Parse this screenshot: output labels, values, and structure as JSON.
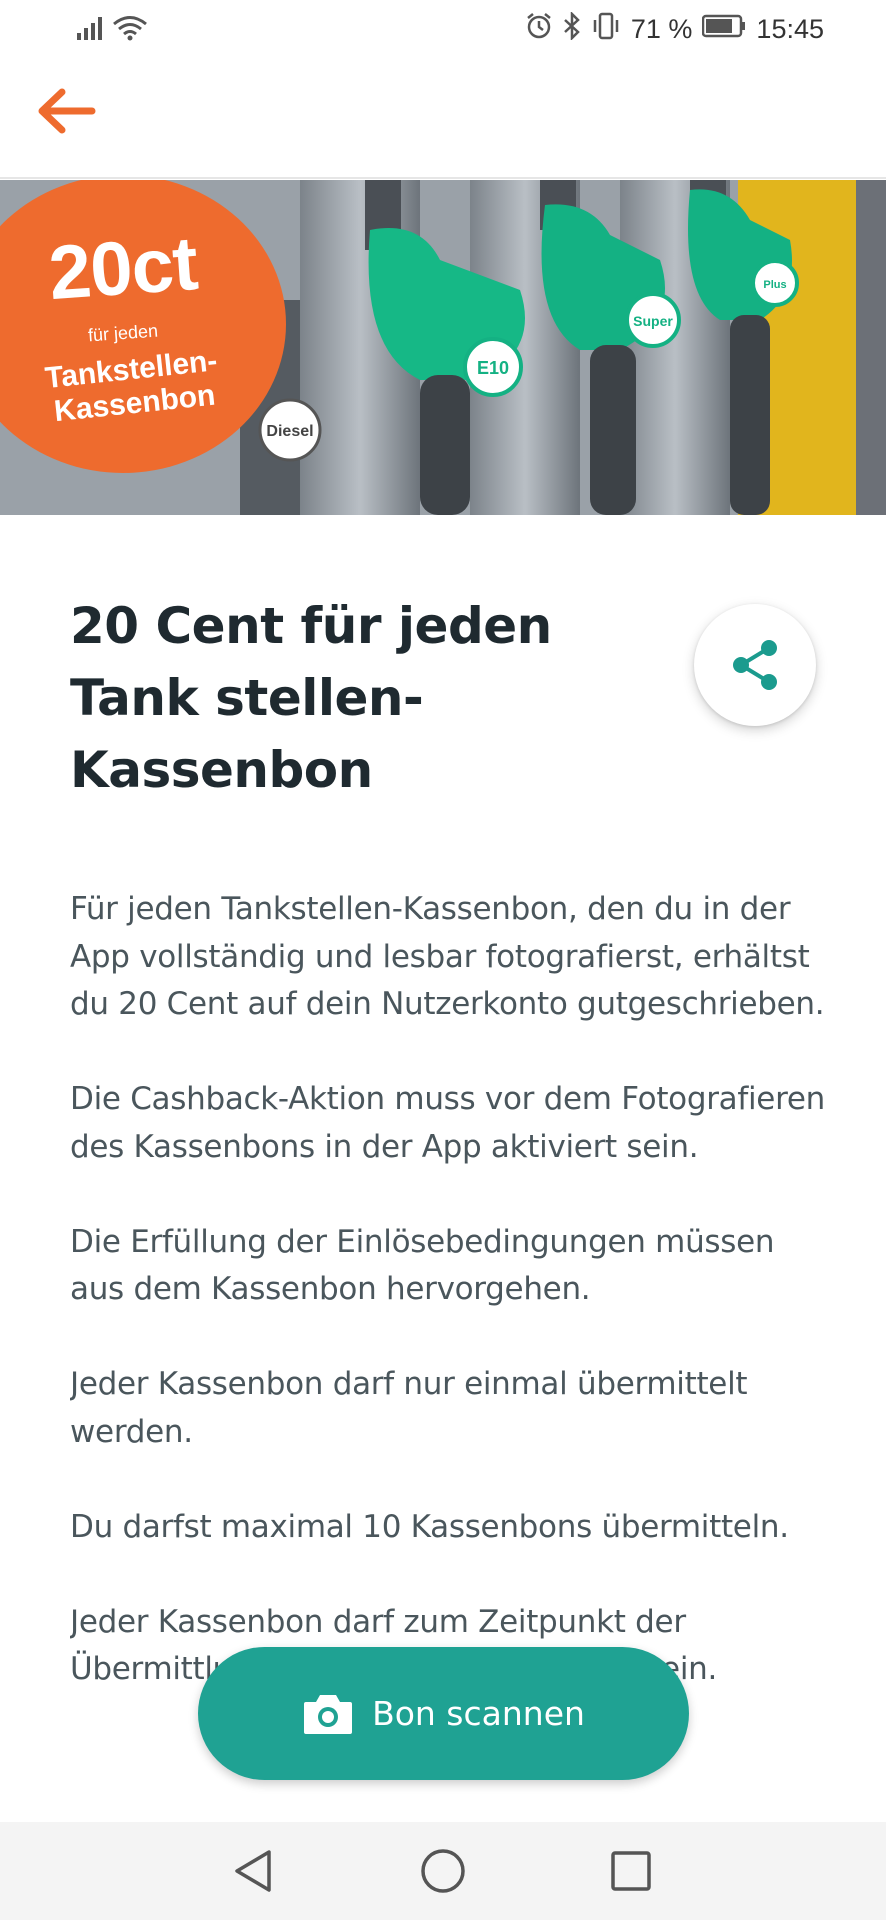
{
  "status_bar": {
    "battery_percent": "71 %",
    "time": "15:45",
    "icons": [
      "signal-icon",
      "wifi-icon",
      "alarm-icon",
      "bluetooth-icon",
      "vibrate-icon",
      "battery-icon"
    ]
  },
  "hero": {
    "badge_amount": "20ct",
    "badge_small": "für jeden",
    "badge_line1": "Tankstellen-",
    "badge_line2": "Kassenbon",
    "nozzle_labels": [
      "Diesel",
      "Super E10",
      "Super",
      "Super Plus"
    ]
  },
  "title": "20 Cent für jeden Tank stellen-Kassenbon",
  "paragraphs": [
    "Für jeden Tankstellen-Kassenbon, den du in der App vollständig und lesbar fotografierst, erhältst du 20 Cent auf dein Nutzerkonto gutgeschrieben.",
    "Die Cashback-Aktion muss vor dem Fotografieren des Kassenbons in der App aktiviert sein.",
    "Die Erfüllung der Einlösebedingungen müssen aus dem Kassenbon hervorgehen.",
    "Jeder Kassenbon darf nur einmal übermittelt werden.",
    "Du darfst maximal 10 Kassenbons übermitteln.",
    "Jeder Kassenbon darf zum Zeitpunkt der Übermittlung nicht älter als drei Tage sein."
  ],
  "fab": {
    "label": "Bon scannen"
  },
  "colors": {
    "accent_orange": "#ee6b2e",
    "accent_teal": "#1fa293",
    "share_icon": "#1b9b8e",
    "title_text": "#1f2a30",
    "body_text": "#4a565c"
  }
}
